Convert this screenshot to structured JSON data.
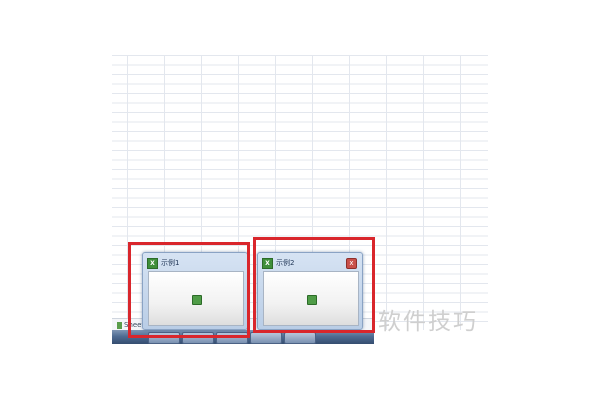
{
  "spreadsheet": {
    "sheet_tab_label": "Sheet1"
  },
  "thumbnails": [
    {
      "title": "示例1",
      "show_close": false
    },
    {
      "title": "示例2",
      "show_close": true,
      "close_glyph": "x"
    }
  ],
  "icons": {
    "app_icon": "excel-icon",
    "close_icon": "close-icon"
  },
  "colors": {
    "highlight": "#d9262c",
    "taskbar": "#4f6c93"
  },
  "watermark": "软件技巧"
}
